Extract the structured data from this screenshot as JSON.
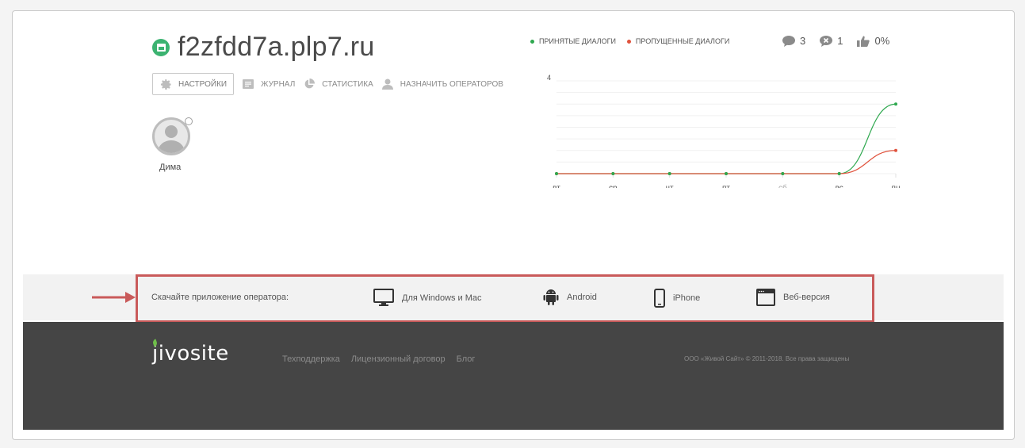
{
  "site": {
    "name": "f2zfdd7a.plp7.ru",
    "icon": "window-icon",
    "icon_color": "#3cb371"
  },
  "nav": [
    {
      "label": "НАСТРОЙКИ",
      "icon": "gear-icon",
      "active": true
    },
    {
      "label": "ЖУРНАЛ",
      "icon": "journal-icon"
    },
    {
      "label": "СТАТИСТИКА",
      "icon": "pie-chart-icon"
    },
    {
      "label": "НАЗНАЧИТЬ ОПЕРАТОРОВ",
      "icon": "user-icon"
    }
  ],
  "operator": {
    "name": "Дима",
    "status": "offline"
  },
  "legend": {
    "accepted": {
      "label": "ПРИНЯТЫЕ ДИАЛОГИ",
      "color": "#2fa84f"
    },
    "missed": {
      "label": "ПРОПУЩЕННЫЕ ДИАЛОГИ",
      "color": "#e0533d"
    }
  },
  "stats": {
    "chats": {
      "value": "3",
      "icon": "chat-bubble-icon"
    },
    "missed": {
      "value": "1",
      "icon": "missed-chat-icon"
    },
    "rating": {
      "value": "0%",
      "icon": "thumbs-up-icon"
    }
  },
  "chart_data": {
    "type": "line",
    "categories": [
      "вт",
      "ср",
      "чт",
      "пт",
      "сб",
      "вс",
      "пн"
    ],
    "ylim": [
      0,
      4
    ],
    "y_tick_label": "4",
    "series": [
      {
        "name": "ПРИНЯТЫЕ ДИАЛОГИ",
        "color": "#2fa84f",
        "values": [
          0,
          0,
          0,
          0,
          0,
          0,
          3
        ]
      },
      {
        "name": "ПРОПУЩЕННЫЕ ДИАЛОГИ",
        "color": "#e0533d",
        "values": [
          0,
          0,
          0,
          0,
          0,
          0,
          1
        ]
      }
    ],
    "grid": true
  },
  "download": {
    "label": "Скачайте приложение оператора:",
    "items": [
      {
        "label": "Для Windows и Mac",
        "icon": "monitor-icon"
      },
      {
        "label": "Android",
        "icon": "android-icon"
      },
      {
        "label": "iPhone",
        "icon": "phone-icon"
      },
      {
        "label": "Веб-версия",
        "icon": "browser-window-icon"
      }
    ],
    "highlight_color": "#c95a5a"
  },
  "footer": {
    "logo": "jivosite",
    "links": [
      "Техподдержка",
      "Лицензионный договор",
      "Блог"
    ],
    "copyright": "ООО «Живой Сайт» © 2011-2018. Все права защищены"
  }
}
